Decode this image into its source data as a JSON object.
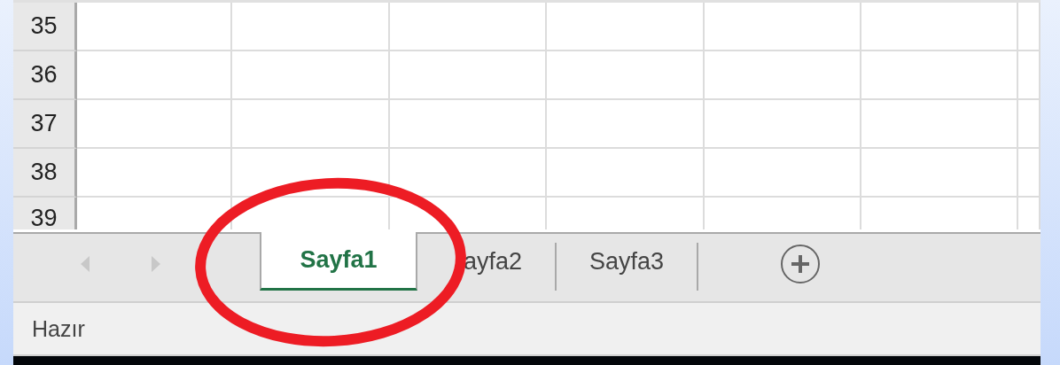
{
  "rows": [
    {
      "number": "35"
    },
    {
      "number": "36"
    },
    {
      "number": "37"
    },
    {
      "number": "38"
    },
    {
      "number": "39"
    }
  ],
  "sheet_tabs": [
    {
      "label": "Sayfa1",
      "selected": true
    },
    {
      "label": "ayfa2",
      "selected": false
    },
    {
      "label": "Sayfa3",
      "selected": false
    }
  ],
  "status_bar": {
    "text": "Hazır"
  },
  "annotation": {
    "kind": "ellipse",
    "color": "#ed1c24"
  }
}
